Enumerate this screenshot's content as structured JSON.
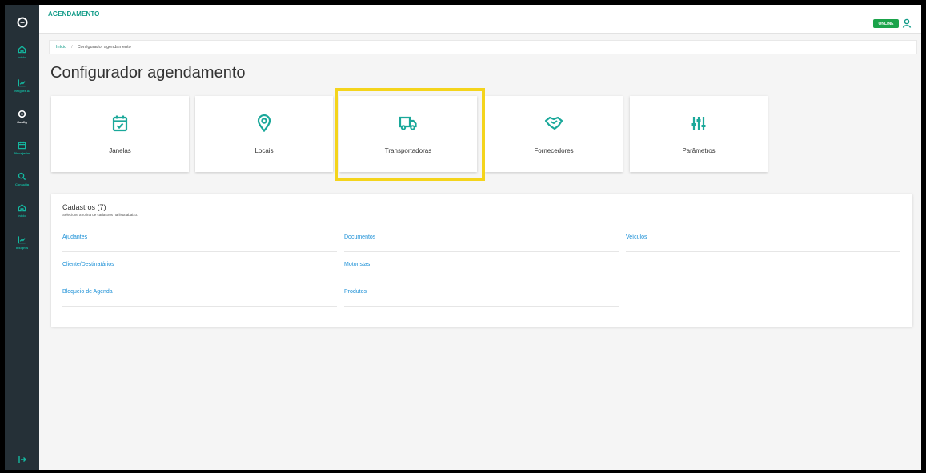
{
  "app": {
    "title": "AGENDAMENTO",
    "status": "ONLINE"
  },
  "sidebar": {
    "items": [
      {
        "label": "Início",
        "icon": "home-icon"
      },
      {
        "label": "Insights AI",
        "icon": "chart-icon"
      },
      {
        "label": "Config",
        "icon": "gear-icon"
      },
      {
        "label": "Planejador",
        "icon": "calendar-icon"
      },
      {
        "label": "Consulta",
        "icon": "search-icon"
      },
      {
        "label": "Início",
        "icon": "home-icon"
      },
      {
        "label": "Insights",
        "icon": "chart-icon"
      }
    ]
  },
  "breadcrumb": {
    "home": "Início",
    "current": "Configurador agendamento"
  },
  "page": {
    "title": "Configurador agendamento"
  },
  "cards": [
    {
      "label": "Janelas",
      "icon": "calendar-check-icon"
    },
    {
      "label": "Locais",
      "icon": "map-pin-icon"
    },
    {
      "label": "Transportadoras",
      "icon": "truck-icon"
    },
    {
      "label": "Fornecedores",
      "icon": "handshake-icon"
    },
    {
      "label": "Parâmetros",
      "icon": "sliders-icon"
    }
  ],
  "cadastros": {
    "title": "Cadastros (7)",
    "subtitle": "Selecione a rotina de cadastros na lista abaixo:",
    "links": {
      "col1": [
        "Ajudantes",
        "Cliente/Destinatários",
        "Bloqueio de Agenda"
      ],
      "col2": [
        "Documentos",
        "Motoristas",
        "Produtos"
      ],
      "col3": [
        "Veículos"
      ]
    }
  },
  "colors": {
    "accent": "#0f9a87",
    "sidebar": "#253037",
    "online": "#1aa34a",
    "highlight": "#f4d41c",
    "link": "#1a8fd6"
  }
}
